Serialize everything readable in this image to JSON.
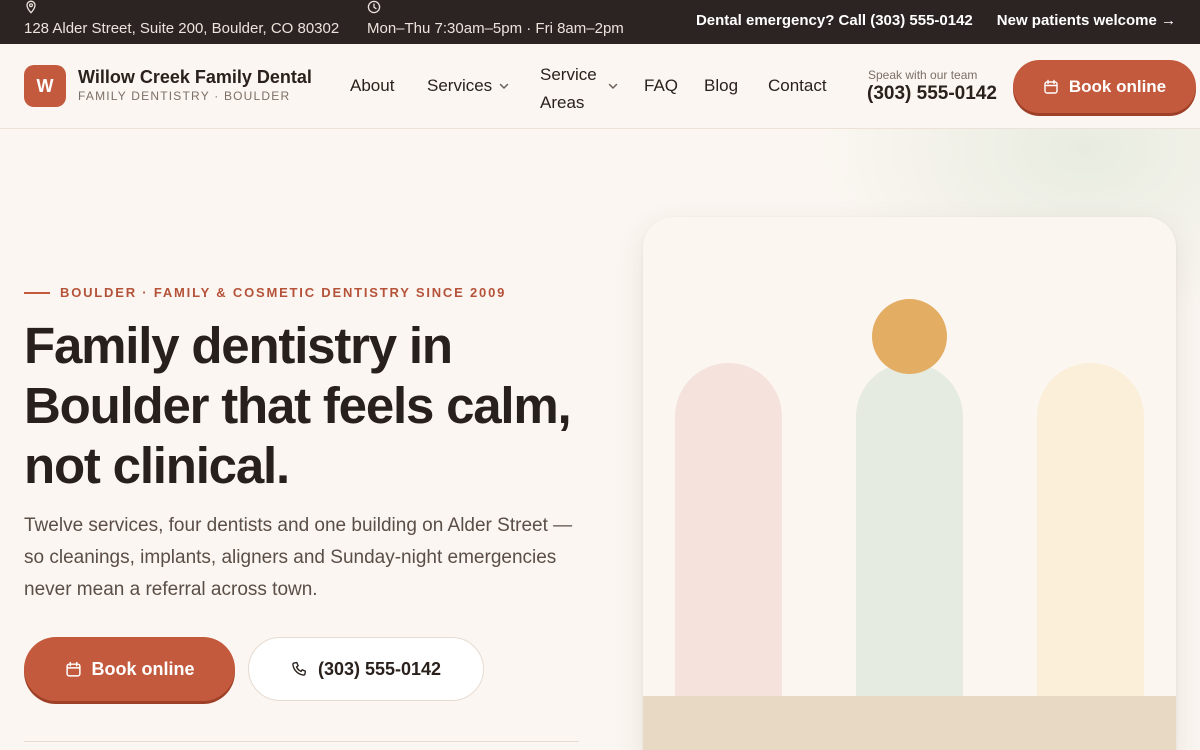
{
  "topbar": {
    "address": "128 Alder Street, Suite 200, Boulder, CO 80302",
    "hours": "Mon–Thu 7:30am–5pm · Fri 8am–2pm",
    "emergency": "Dental emergency? Call (303) 555-0142",
    "new_patients": "New patients welcome →"
  },
  "brand": {
    "initial": "W",
    "name": "Willow Creek Family Dental",
    "tagline": "FAMILY DENTISTRY · BOULDER"
  },
  "nav": {
    "about": "About",
    "services": "Services",
    "service_areas": "Service Areas",
    "faq": "FAQ",
    "blog": "Blog",
    "contact": "Contact"
  },
  "header_contact": {
    "label": "Speak with our team",
    "phone": "(303) 555-0142",
    "book": "Book online"
  },
  "hero": {
    "eyebrow": "BOULDER · FAMILY & COSMETIC DENTISTRY SINCE 2009",
    "title": "Family dentistry in Boulder that feels calm, not clinical.",
    "description": "Twelve services, four dentists and one building on Alder Street — so cleanings, implants, aligners and Sunday-night emergencies never mean a referral across town.",
    "book_button": "Book online",
    "phone_button": "(303) 555-0142"
  },
  "colors": {
    "accent": "#c45a3d",
    "topbar": "#2c2422",
    "background": "#fbf6f1"
  },
  "icons": {
    "address": "map-pin-icon",
    "hours": "clock-icon",
    "book": "calendar-icon",
    "phone": "phone-icon",
    "dropdown": "chevron-down-icon"
  }
}
